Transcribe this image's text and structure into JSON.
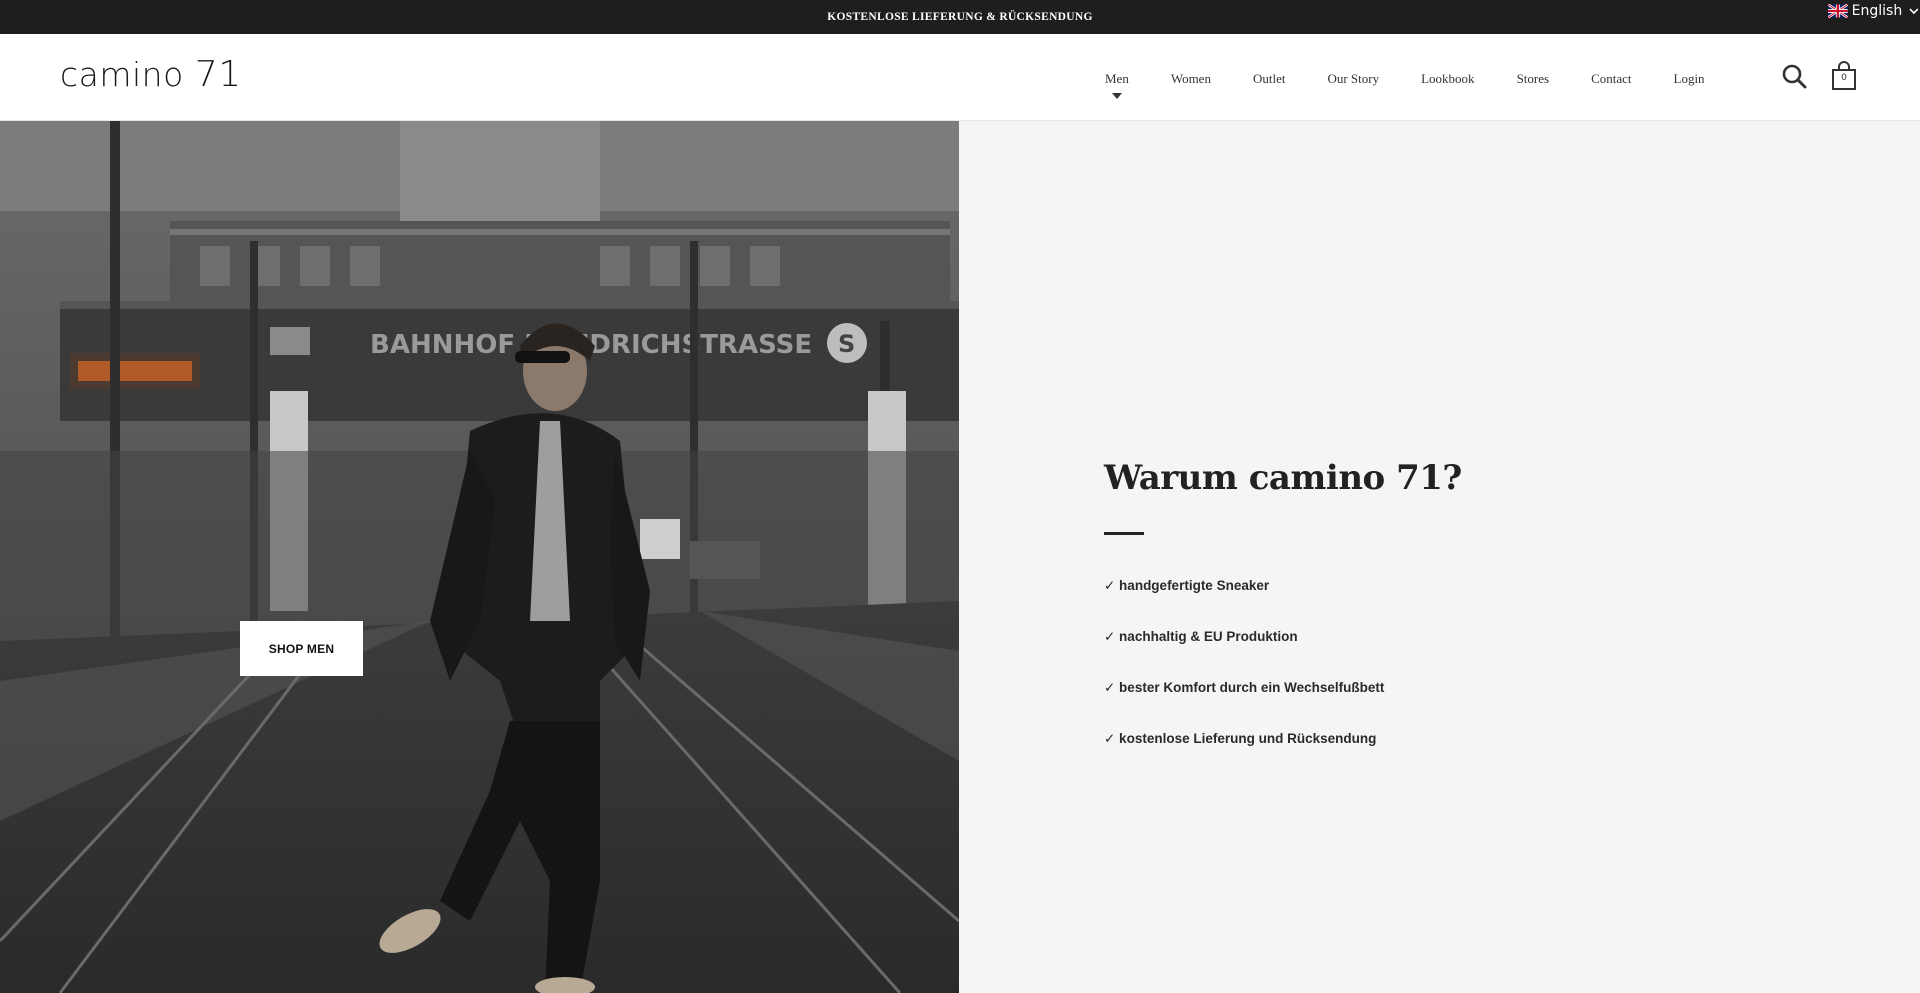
{
  "announcement": {
    "text": "KOSTENLOSE LIEFERUNG & RÜCKSENDUNG"
  },
  "language": {
    "label": "English",
    "flag_icon": "uk-flag-icon"
  },
  "header": {
    "logo_text": "camino",
    "logo_number": "71",
    "nav": [
      {
        "label": "Men",
        "has_dropdown": true
      },
      {
        "label": "Women"
      },
      {
        "label": "Outlet"
      },
      {
        "label": "Our Story"
      },
      {
        "label": "Lookbook"
      },
      {
        "label": "Stores"
      },
      {
        "label": "Contact"
      },
      {
        "label": "Login"
      }
    ],
    "cart_count": "0"
  },
  "hero": {
    "image_sign_text": "BAHNHOF FRIEDRICHSTRASSE",
    "shop_button_label": "SHOP MEN"
  },
  "why": {
    "title": "Warum camino 71?",
    "items": [
      "✓ handgefertigte Sneaker",
      "✓ nachhaltig & EU Produktion",
      "✓ bester Komfort durch ein Wechselfußbett",
      "✓ kostenlose Lieferung und Rücksendung"
    ]
  },
  "colors": {
    "announce_bg": "#1e1e1e",
    "panel_bg": "#f5f5f5",
    "text": "#222222"
  }
}
